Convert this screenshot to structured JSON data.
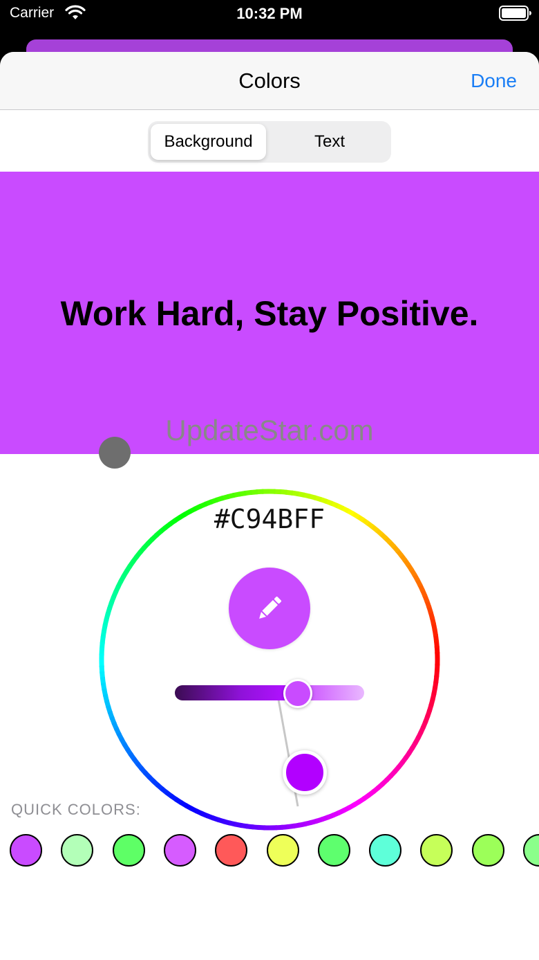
{
  "status_bar": {
    "carrier": "Carrier",
    "time": "10:32 PM"
  },
  "nav": {
    "title": "Colors",
    "done": "Done"
  },
  "segmented": {
    "background": "Background",
    "text": "Text",
    "selected": "Background"
  },
  "preview": {
    "text": "Work Hard, Stay Positive.",
    "background_color": "#C94BFF",
    "text_color": "#000000"
  },
  "watermark": "UpdateStar.com",
  "picker": {
    "hex": "#C94BFF",
    "edit_icon": "pencil-icon",
    "brightness_level": 0.65
  },
  "quick_colors": {
    "label": "QUICK COLORS:",
    "swatches": [
      "#c94bff",
      "#b3ffb8",
      "#5eff66",
      "#d65cff",
      "#ff5959",
      "#eeff59",
      "#5eff6e",
      "#5effd9",
      "#c6ff59",
      "#9cff59",
      "#8bff8b"
    ]
  }
}
